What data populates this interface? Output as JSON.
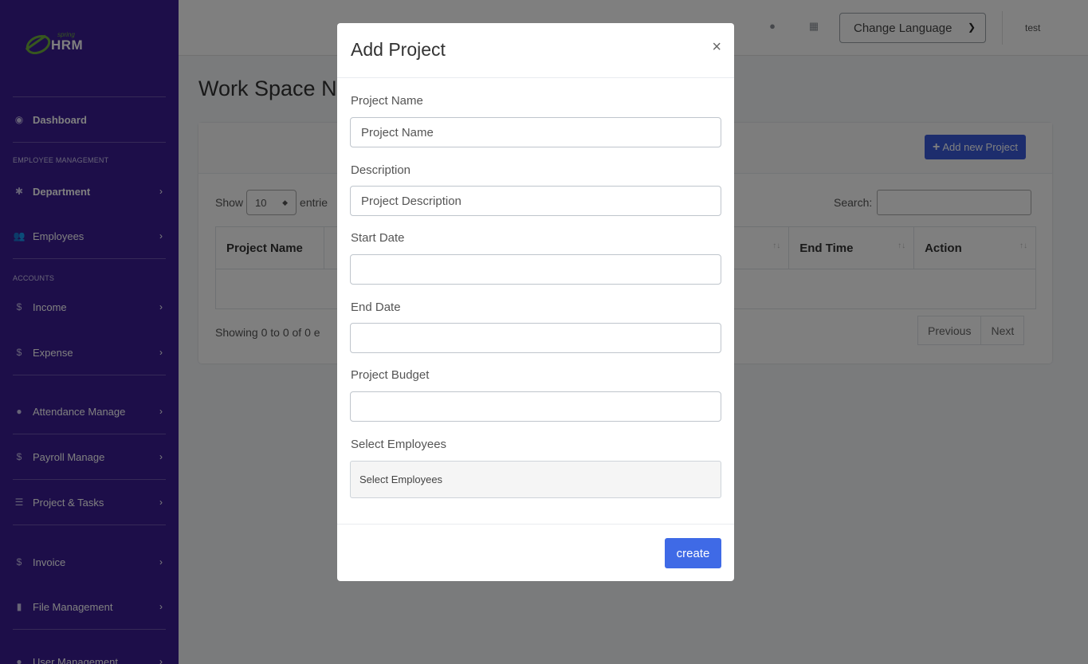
{
  "sidebar": {
    "logo_small": "spring",
    "logo_big": "HRM",
    "dashboard": "Dashboard",
    "section_employee": "EMPLOYEE MANAGEMENT",
    "department": "Department",
    "employees": "Employees",
    "section_accounts": "ACCOUNTS",
    "income": "Income",
    "expense": "Expense",
    "attendance": "Attendance Manage",
    "payroll": "Payroll Manage",
    "project_tasks": "Project & Tasks",
    "invoice": "Invoice",
    "file_management": "File Management",
    "user_management": "User Management"
  },
  "topbar": {
    "language_select": "Change Language",
    "user": "test"
  },
  "main": {
    "page_title": "Work Space N",
    "add_button": "Add new Project",
    "show_label": "Show",
    "page_length": "10",
    "entries_label": "entrie",
    "search_label": "Search:",
    "columns": [
      "Project Name",
      "",
      "End Time",
      "Action"
    ],
    "showing": "Showing 0 to 0 of 0 e",
    "prev": "Previous",
    "next": "Next"
  },
  "modal": {
    "title": "Add Project",
    "close": "×",
    "project_name_label": "Project Name",
    "project_name_placeholder": "Project Name",
    "description_label": "Description",
    "description_placeholder": "Project Description",
    "start_date_label": "Start Date",
    "end_date_label": "End Date",
    "budget_label": "Project Budget",
    "employees_label": "Select Employees",
    "employees_placeholder": "Select Employees",
    "create": "create"
  }
}
